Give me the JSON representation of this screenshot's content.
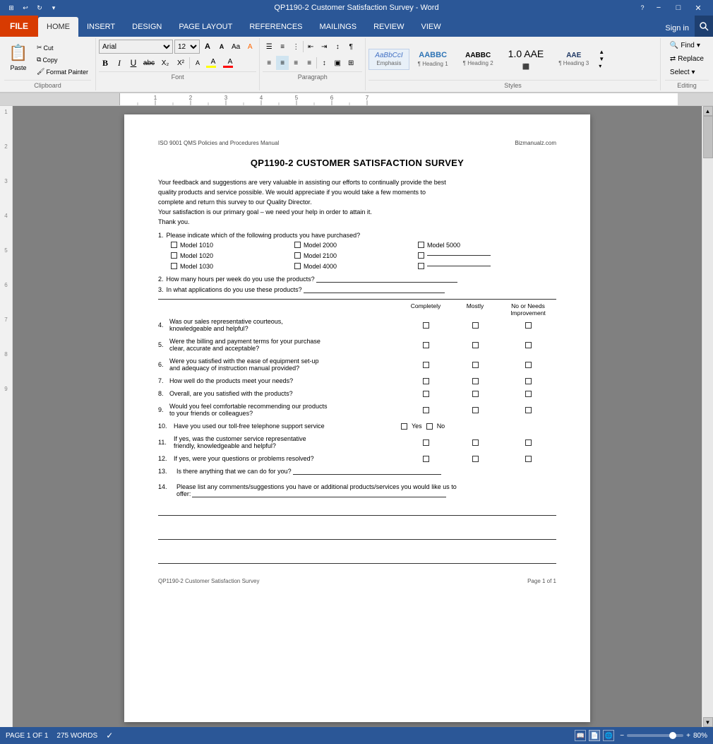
{
  "titleBar": {
    "title": "QP1190-2 Customer Satisfaction Survey - Word",
    "controls": [
      "−",
      "□",
      "✕"
    ],
    "icons": [
      "⊞",
      "↩",
      "↻",
      "▾"
    ]
  },
  "ribbon": {
    "filTab": "FILE",
    "tabs": [
      "HOME",
      "INSERT",
      "DESIGN",
      "PAGE LAYOUT",
      "REFERENCES",
      "MAILINGS",
      "REVIEW",
      "VIEW"
    ],
    "activeTab": "HOME",
    "signIn": "Sign in",
    "clipboard": {
      "label": "Clipboard",
      "paste": "Paste",
      "cut": "Cut",
      "copy": "Copy",
      "formatPainter": "Format Painter"
    },
    "font": {
      "label": "Font",
      "name": "Arial",
      "size": "12",
      "bold": "B",
      "italic": "I",
      "underline": "U",
      "strikethrough": "abc",
      "sub": "X₂",
      "sup": "X²"
    },
    "paragraph": {
      "label": "Paragraph"
    },
    "styles": {
      "label": "Styles",
      "items": [
        {
          "name": "AaBbCcI",
          "label": "Emphasis",
          "class": "style-emphasis"
        },
        {
          "name": "AABBC",
          "label": "Heading 1",
          "class": "style-heading1"
        },
        {
          "name": "AABBC",
          "label": "Heading 2",
          "class": "style-heading2"
        },
        {
          "name": "1.0 AAE",
          "label": "1.0 AAE",
          "class": ""
        },
        {
          "name": "AAE",
          "label": "Heading 3",
          "class": "style-heading3"
        }
      ]
    },
    "editing": {
      "label": "Editing",
      "find": "Find",
      "replace": "Replace",
      "select": "Select ▾"
    }
  },
  "document": {
    "header": {
      "left": "ISO 9001 QMS Policies and Procedures Manual",
      "right": "Bizmanualz.com"
    },
    "title": "QP1190-2 CUSTOMER SATISFACTION SURVEY",
    "intro": [
      "Your feedback and suggestions are very valuable in assisting our efforts to continually provide the best",
      "quality products and service possible.  We would appreciate if you would take a few moments to",
      "complete and return this survey to our Quality Director.",
      "Your satisfaction is our primary goal – we need your help in order to attain it.",
      "Thank you."
    ],
    "questions": [
      {
        "num": "1.",
        "text": "Please indicate which of the following products you have purchased?",
        "type": "products"
      },
      {
        "num": "2.",
        "text": "How many hours per week do you use the products?",
        "type": "fillline"
      },
      {
        "num": "3.",
        "text": "In what applications do you use these products?",
        "type": "fillline"
      }
    ],
    "products": [
      [
        "Model 1010",
        "Model 2000",
        "Model 5000"
      ],
      [
        "Model 1020",
        "Model 2100",
        "_______________"
      ],
      [
        "Model 1030",
        "Model 4000",
        "_______________"
      ]
    ],
    "ratingHeader": {
      "cols": [
        "Completely",
        "Mostly",
        "No or Needs\nImprovement"
      ]
    },
    "ratingQuestions": [
      {
        "num": "4.",
        "text": "Was our sales representative courteous,\nknowledgeable and helpful?"
      },
      {
        "num": "5.",
        "text": "Were the billing and payment terms for your purchase\nclear, accurate and acceptable?"
      },
      {
        "num": "6.",
        "text": "Were you satisfied with the ease of equipment set-up\nand adequacy of instruction manual provided?"
      },
      {
        "num": "7.",
        "text": "How well do the products meet your needs?"
      },
      {
        "num": "8.",
        "text": "Overall, are you satisfied with the products?"
      },
      {
        "num": "9.",
        "text": "Would you feel comfortable recommending our products\nto your friends or colleagues?"
      },
      {
        "num": "10.",
        "text": "Have you used our toll-free telephone support service",
        "special": "yes_no"
      },
      {
        "num": "11.",
        "text": "If yes, was the customer service representative\nfriendly, knowledgeable and helpful?"
      },
      {
        "num": "12.",
        "text": "If yes, were your questions or problems resolved?"
      },
      {
        "num": "13.",
        "text": "Is there anything that we can do for you?",
        "type": "fillline"
      }
    ],
    "q14": {
      "num": "14.",
      "text": "Please list any comments/suggestions you have or additional products/services you would like us to offer:"
    },
    "footer": {
      "left": "QP1190-2 Customer Satisfaction Survey",
      "right": "Page 1 of 1"
    }
  },
  "statusBar": {
    "page": "PAGE 1 OF 1",
    "words": "275 WORDS",
    "zoom": "80%"
  }
}
